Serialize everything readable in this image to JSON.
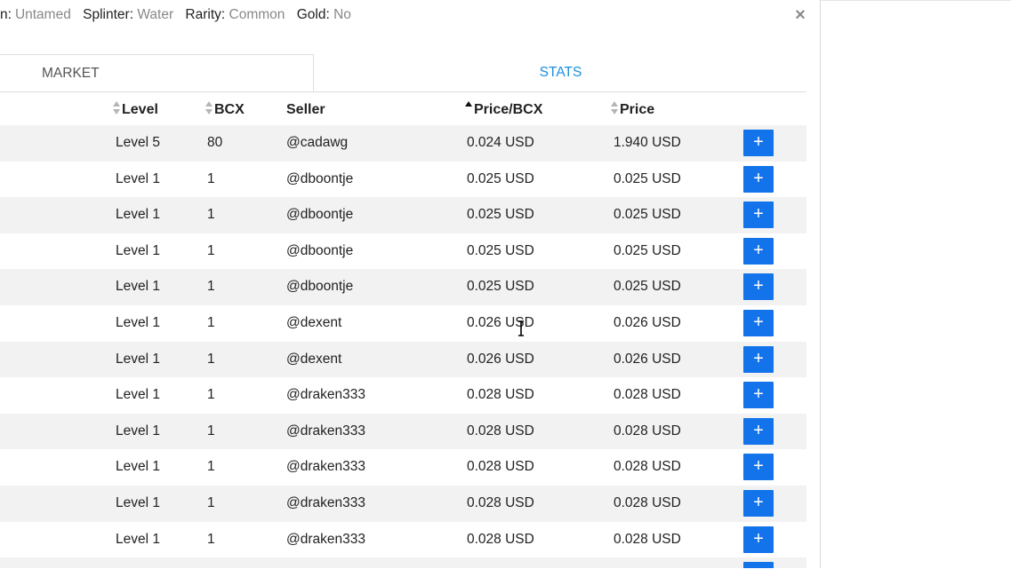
{
  "card_info": {
    "edition_label_tail": "n:",
    "edition_value": "Untamed",
    "splinter_label": "Splinter:",
    "splinter_value": "Water",
    "rarity_label": "Rarity:",
    "rarity_value": "Common",
    "gold_label": "Gold:",
    "gold_value": "No"
  },
  "close_icon": "×",
  "tabs": [
    {
      "label": "MARKET",
      "active": true
    },
    {
      "label": "STATS",
      "active": false
    }
  ],
  "columns": {
    "level": "Level",
    "bcx": "BCX",
    "seller": "Seller",
    "price_per_bcx": "Price/BCX",
    "price": "Price"
  },
  "sort": {
    "column": "Price/BCX",
    "direction": "ascending"
  },
  "add_button_label": "+",
  "rows": [
    {
      "level": "Level 5",
      "bcx": "80",
      "seller": "@cadawg",
      "price_per_bcx": "0.024 USD",
      "price": "1.940 USD"
    },
    {
      "level": "Level 1",
      "bcx": "1",
      "seller": "@dboontje",
      "price_per_bcx": "0.025 USD",
      "price": "0.025 USD"
    },
    {
      "level": "Level 1",
      "bcx": "1",
      "seller": "@dboontje",
      "price_per_bcx": "0.025 USD",
      "price": "0.025 USD"
    },
    {
      "level": "Level 1",
      "bcx": "1",
      "seller": "@dboontje",
      "price_per_bcx": "0.025 USD",
      "price": "0.025 USD"
    },
    {
      "level": "Level 1",
      "bcx": "1",
      "seller": "@dboontje",
      "price_per_bcx": "0.025 USD",
      "price": "0.025 USD"
    },
    {
      "level": "Level 1",
      "bcx": "1",
      "seller": "@dexent",
      "price_per_bcx": "0.026 USD",
      "price": "0.026 USD"
    },
    {
      "level": "Level 1",
      "bcx": "1",
      "seller": "@dexent",
      "price_per_bcx": "0.026 USD",
      "price": "0.026 USD"
    },
    {
      "level": "Level 1",
      "bcx": "1",
      "seller": "@draken333",
      "price_per_bcx": "0.028 USD",
      "price": "0.028 USD"
    },
    {
      "level": "Level 1",
      "bcx": "1",
      "seller": "@draken333",
      "price_per_bcx": "0.028 USD",
      "price": "0.028 USD"
    },
    {
      "level": "Level 1",
      "bcx": "1",
      "seller": "@draken333",
      "price_per_bcx": "0.028 USD",
      "price": "0.028 USD"
    },
    {
      "level": "Level 1",
      "bcx": "1",
      "seller": "@draken333",
      "price_per_bcx": "0.028 USD",
      "price": "0.028 USD"
    },
    {
      "level": "Level 1",
      "bcx": "1",
      "seller": "@draken333",
      "price_per_bcx": "0.028 USD",
      "price": "0.028 USD"
    },
    {
      "level": "",
      "bcx": "",
      "seller": "",
      "price_per_bcx": "",
      "price": ""
    }
  ]
}
